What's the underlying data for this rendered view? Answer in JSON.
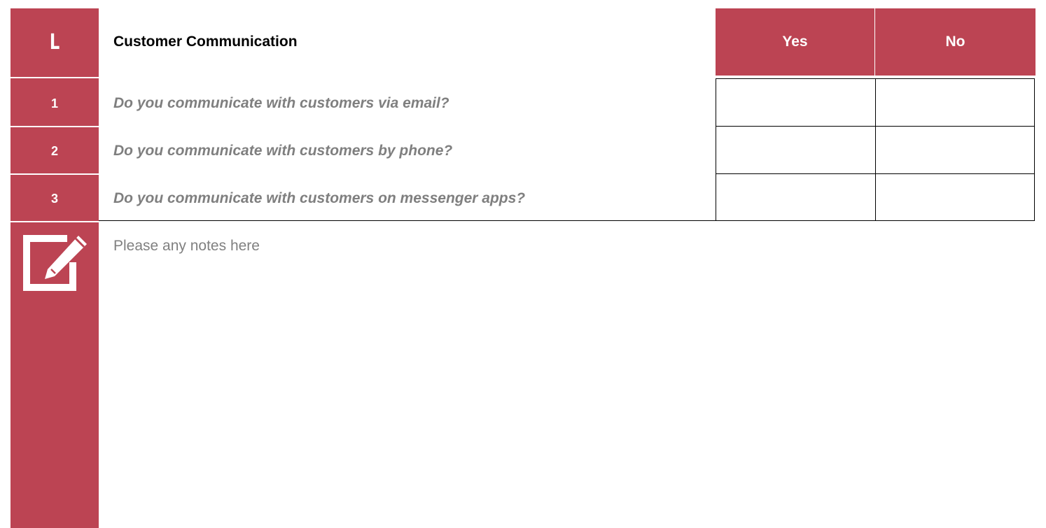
{
  "section": {
    "letter": "L",
    "title": "Customer Communication",
    "yes_label": "Yes",
    "no_label": "No"
  },
  "questions": [
    {
      "number": "1",
      "text": "Do you communicate with customers via email?"
    },
    {
      "number": "2",
      "text": "Do you communicate with customers by phone?"
    },
    {
      "number": "3",
      "text": "Do you communicate with customers on messenger apps?"
    }
  ],
  "notes": {
    "icon": "edit-note-icon",
    "text": "Please any notes here"
  },
  "colors": {
    "accent": "#bc4453",
    "question_text": "#7f7f7f",
    "notes_text": "#808080"
  }
}
